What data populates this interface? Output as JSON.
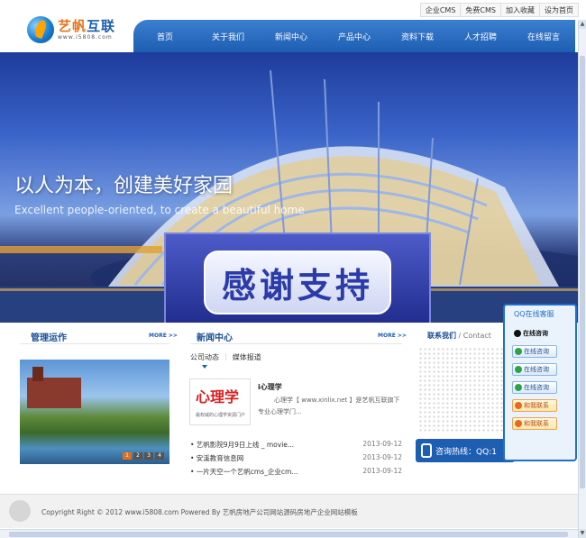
{
  "toplinks": [
    "企业CMS",
    "免费CMS",
    "加入收藏",
    "设为首页"
  ],
  "logo": {
    "name_a": "艺帆",
    "name_b": "互联",
    "url": "www.i5808.com"
  },
  "nav": [
    "首页",
    "关于我们",
    "新闻中心",
    "产品中心",
    "资料下载",
    "人才招聘",
    "在线留言"
  ],
  "banner": {
    "slogan": "以人为本，创建美好家园",
    "subtitle": "Excellent people-oriented, to create a beautiful home",
    "overlay": "感谢支持"
  },
  "sections": {
    "management": {
      "title": "管理运作",
      "more": "MORE >>",
      "pager": [
        "1",
        "2",
        "3",
        "4"
      ]
    },
    "news": {
      "title": "新闻中心",
      "more": "MORE >>",
      "tabs": [
        "公司动态",
        "媒体报道"
      ],
      "featured": {
        "image_big": "心理学",
        "image_small": "最权威的心理学资源门户",
        "title": "i心理学",
        "desc": "心理学【 www.xinlix.net 】是艺帆互联旗下专业心理学门..."
      },
      "items": [
        {
          "title": "• 艺帆影院9月9日上线 _ movie...",
          "date": "2013-09-12"
        },
        {
          "title": "• 安溪教育信息网",
          "date": "2013-09-12"
        },
        {
          "title": "• 一片天空一个艺帆cms_企业cm...",
          "date": "2013-09-12"
        }
      ]
    },
    "contact": {
      "title": "联系我们",
      "title_en": "/ Contact",
      "hotline": "咨询热线：QQ:1"
    }
  },
  "qq_panel": {
    "title": "QQ在线客服",
    "buttons": [
      "在线咨询",
      "在线咨询",
      "在线咨询",
      "在线咨询",
      "和我联系",
      "和我联系"
    ]
  },
  "footer": {
    "text": "Copyright Right © 2012 www.i5808.com Powered By 艺帆房地产公司网站源码房地产企业网站模板"
  }
}
